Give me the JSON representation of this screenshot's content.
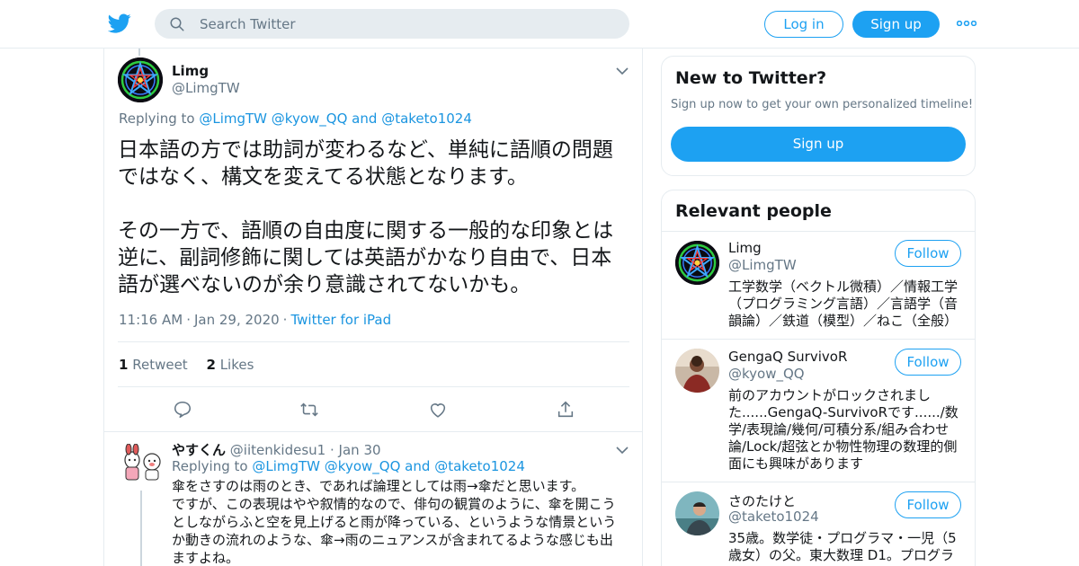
{
  "colors": {
    "accent": "#1da1f2",
    "link": "#1b95e0",
    "muted": "#657786",
    "border": "#e6ecf0"
  },
  "header": {
    "logo_icon": "twitter-bird-icon",
    "search_placeholder": "Search Twitter",
    "login_label": "Log in",
    "signup_label": "Sign up",
    "more_icon": "more-dots-icon"
  },
  "tweet": {
    "name": "Limg",
    "handle": "@LimgTW",
    "replying_prefix": "Replying to",
    "replying_to": [
      "@LimgTW",
      "@kyow_QQ",
      "@taketo1024"
    ],
    "replying_and": "and",
    "text": "日本語の方では助詞が変わるなど、単純に語順の問題ではなく、構文を変えてる状態となります。\n\nその一方で、語順の自由度に関する一般的な印象とは逆に、副詞修飾に関しては英語がかなり自由で、日本語が選べないのが余り意識されてないかも。",
    "time": "11:16 AM",
    "date": "Jan 29, 2020",
    "source": "Twitter for iPad",
    "retweets": {
      "count": "1",
      "label": "Retweet"
    },
    "likes": {
      "count": "2",
      "label": "Likes"
    },
    "actions": [
      "reply-icon",
      "retweet-icon",
      "like-icon",
      "share-icon"
    ]
  },
  "reply": {
    "name": "やすくん",
    "handle": "@iitenkidesu1",
    "date": "Jan 30",
    "replying_prefix": "Replying to",
    "replying_to": [
      "@LimgTW",
      "@kyow_QQ",
      "@taketo1024"
    ],
    "replying_and": "and",
    "text": "傘をさすのは雨のとき、であれば論理としては雨→傘だと思います。\nですが、この表現はやや叙情的なので、俳句の観賞のように、傘を開こうとしながらふと空を見上げると雨が降っている、というような情景というか動きの流れのような、傘→雨のニュアンスが含まれてるような感じも出ますよね。"
  },
  "sidebar": {
    "new_title": "New to Twitter?",
    "new_sub": "Sign up now to get your own personalized timeline!",
    "new_signup": "Sign up",
    "relevant_title": "Relevant people",
    "follow_label": "Follow",
    "people": [
      {
        "name": "Limg",
        "handle": "@LimgTW",
        "bio": "工学数学（ベクトル微積）／情報工学（プログラミング言語）／言語学（音韻論）／鉄道（模型）／ねこ（全般）"
      },
      {
        "name": "GengaQ SurvivoR",
        "handle": "@kyow_QQ",
        "bio": "前のアカウントがロックされました......GengaQ-SurvivoRです....../数学/表現論/幾何/可積分系/組み合わせ論/Lock/超弦とか物性物理の数理的側面にも興味があります"
      },
      {
        "name": "さのたけと",
        "handle": "@taketo1024",
        "bio": "35歳。数学徒・プログラマ・一児（5歳女）の父。東大数理 D1。プログラ"
      }
    ]
  }
}
